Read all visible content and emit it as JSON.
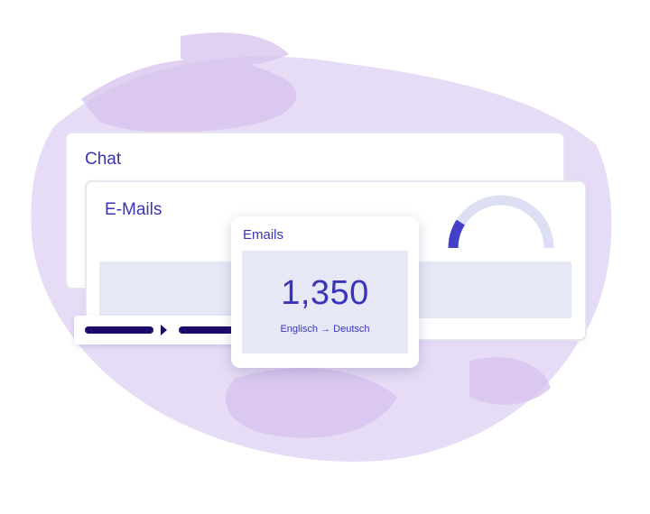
{
  "chat_card": {
    "title": "Chat"
  },
  "email_card": {
    "title": "E-Mails",
    "gauge_fraction": 0.18
  },
  "popup": {
    "title": "Emails",
    "value": "1,350",
    "caption": "Englisch → Deutsch"
  },
  "colors": {
    "accent": "#3a35b8",
    "panel": "#e7e8f6",
    "bar_dark": "#1d0a6b",
    "gauge_track": "#dddff2",
    "gauge_fill": "#4540c8",
    "brush": "#d8c8ef"
  }
}
